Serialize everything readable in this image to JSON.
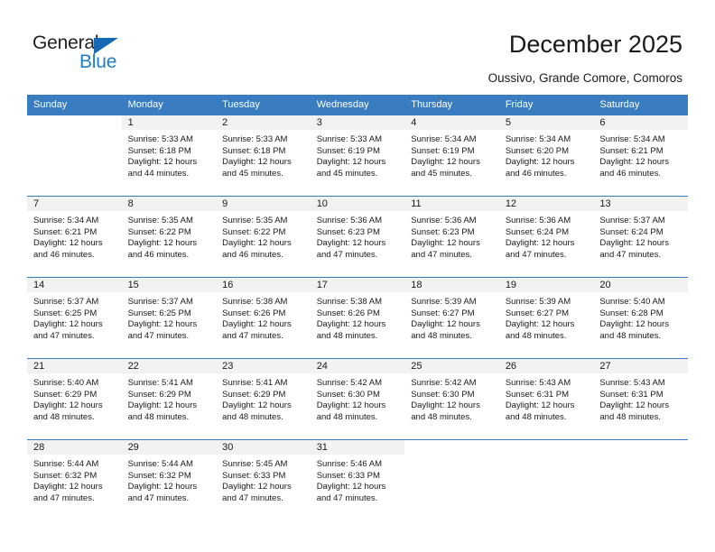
{
  "brand": {
    "name_part1": "General",
    "name_part2": "Blue",
    "accent_color": "#1f7fc4",
    "triangle_color": "#1769b5"
  },
  "header": {
    "title": "December 2025",
    "subtitle": "Oussivo, Grande Comore, Comoros"
  },
  "calendar": {
    "header_bg": "#3a7cc0",
    "weekdays": [
      "Sunday",
      "Monday",
      "Tuesday",
      "Wednesday",
      "Thursday",
      "Friday",
      "Saturday"
    ],
    "weeks": [
      [
        {
          "day": "",
          "sunrise": "",
          "sunset": "",
          "daylight1": "",
          "daylight2": ""
        },
        {
          "day": "1",
          "sunrise": "Sunrise: 5:33 AM",
          "sunset": "Sunset: 6:18 PM",
          "daylight1": "Daylight: 12 hours",
          "daylight2": "and 44 minutes."
        },
        {
          "day": "2",
          "sunrise": "Sunrise: 5:33 AM",
          "sunset": "Sunset: 6:18 PM",
          "daylight1": "Daylight: 12 hours",
          "daylight2": "and 45 minutes."
        },
        {
          "day": "3",
          "sunrise": "Sunrise: 5:33 AM",
          "sunset": "Sunset: 6:19 PM",
          "daylight1": "Daylight: 12 hours",
          "daylight2": "and 45 minutes."
        },
        {
          "day": "4",
          "sunrise": "Sunrise: 5:34 AM",
          "sunset": "Sunset: 6:19 PM",
          "daylight1": "Daylight: 12 hours",
          "daylight2": "and 45 minutes."
        },
        {
          "day": "5",
          "sunrise": "Sunrise: 5:34 AM",
          "sunset": "Sunset: 6:20 PM",
          "daylight1": "Daylight: 12 hours",
          "daylight2": "and 46 minutes."
        },
        {
          "day": "6",
          "sunrise": "Sunrise: 5:34 AM",
          "sunset": "Sunset: 6:21 PM",
          "daylight1": "Daylight: 12 hours",
          "daylight2": "and 46 minutes."
        }
      ],
      [
        {
          "day": "7",
          "sunrise": "Sunrise: 5:34 AM",
          "sunset": "Sunset: 6:21 PM",
          "daylight1": "Daylight: 12 hours",
          "daylight2": "and 46 minutes."
        },
        {
          "day": "8",
          "sunrise": "Sunrise: 5:35 AM",
          "sunset": "Sunset: 6:22 PM",
          "daylight1": "Daylight: 12 hours",
          "daylight2": "and 46 minutes."
        },
        {
          "day": "9",
          "sunrise": "Sunrise: 5:35 AM",
          "sunset": "Sunset: 6:22 PM",
          "daylight1": "Daylight: 12 hours",
          "daylight2": "and 46 minutes."
        },
        {
          "day": "10",
          "sunrise": "Sunrise: 5:36 AM",
          "sunset": "Sunset: 6:23 PM",
          "daylight1": "Daylight: 12 hours",
          "daylight2": "and 47 minutes."
        },
        {
          "day": "11",
          "sunrise": "Sunrise: 5:36 AM",
          "sunset": "Sunset: 6:23 PM",
          "daylight1": "Daylight: 12 hours",
          "daylight2": "and 47 minutes."
        },
        {
          "day": "12",
          "sunrise": "Sunrise: 5:36 AM",
          "sunset": "Sunset: 6:24 PM",
          "daylight1": "Daylight: 12 hours",
          "daylight2": "and 47 minutes."
        },
        {
          "day": "13",
          "sunrise": "Sunrise: 5:37 AM",
          "sunset": "Sunset: 6:24 PM",
          "daylight1": "Daylight: 12 hours",
          "daylight2": "and 47 minutes."
        }
      ],
      [
        {
          "day": "14",
          "sunrise": "Sunrise: 5:37 AM",
          "sunset": "Sunset: 6:25 PM",
          "daylight1": "Daylight: 12 hours",
          "daylight2": "and 47 minutes."
        },
        {
          "day": "15",
          "sunrise": "Sunrise: 5:37 AM",
          "sunset": "Sunset: 6:25 PM",
          "daylight1": "Daylight: 12 hours",
          "daylight2": "and 47 minutes."
        },
        {
          "day": "16",
          "sunrise": "Sunrise: 5:38 AM",
          "sunset": "Sunset: 6:26 PM",
          "daylight1": "Daylight: 12 hours",
          "daylight2": "and 47 minutes."
        },
        {
          "day": "17",
          "sunrise": "Sunrise: 5:38 AM",
          "sunset": "Sunset: 6:26 PM",
          "daylight1": "Daylight: 12 hours",
          "daylight2": "and 48 minutes."
        },
        {
          "day": "18",
          "sunrise": "Sunrise: 5:39 AM",
          "sunset": "Sunset: 6:27 PM",
          "daylight1": "Daylight: 12 hours",
          "daylight2": "and 48 minutes."
        },
        {
          "day": "19",
          "sunrise": "Sunrise: 5:39 AM",
          "sunset": "Sunset: 6:27 PM",
          "daylight1": "Daylight: 12 hours",
          "daylight2": "and 48 minutes."
        },
        {
          "day": "20",
          "sunrise": "Sunrise: 5:40 AM",
          "sunset": "Sunset: 6:28 PM",
          "daylight1": "Daylight: 12 hours",
          "daylight2": "and 48 minutes."
        }
      ],
      [
        {
          "day": "21",
          "sunrise": "Sunrise: 5:40 AM",
          "sunset": "Sunset: 6:29 PM",
          "daylight1": "Daylight: 12 hours",
          "daylight2": "and 48 minutes."
        },
        {
          "day": "22",
          "sunrise": "Sunrise: 5:41 AM",
          "sunset": "Sunset: 6:29 PM",
          "daylight1": "Daylight: 12 hours",
          "daylight2": "and 48 minutes."
        },
        {
          "day": "23",
          "sunrise": "Sunrise: 5:41 AM",
          "sunset": "Sunset: 6:29 PM",
          "daylight1": "Daylight: 12 hours",
          "daylight2": "and 48 minutes."
        },
        {
          "day": "24",
          "sunrise": "Sunrise: 5:42 AM",
          "sunset": "Sunset: 6:30 PM",
          "daylight1": "Daylight: 12 hours",
          "daylight2": "and 48 minutes."
        },
        {
          "day": "25",
          "sunrise": "Sunrise: 5:42 AM",
          "sunset": "Sunset: 6:30 PM",
          "daylight1": "Daylight: 12 hours",
          "daylight2": "and 48 minutes."
        },
        {
          "day": "26",
          "sunrise": "Sunrise: 5:43 AM",
          "sunset": "Sunset: 6:31 PM",
          "daylight1": "Daylight: 12 hours",
          "daylight2": "and 48 minutes."
        },
        {
          "day": "27",
          "sunrise": "Sunrise: 5:43 AM",
          "sunset": "Sunset: 6:31 PM",
          "daylight1": "Daylight: 12 hours",
          "daylight2": "and 48 minutes."
        }
      ],
      [
        {
          "day": "28",
          "sunrise": "Sunrise: 5:44 AM",
          "sunset": "Sunset: 6:32 PM",
          "daylight1": "Daylight: 12 hours",
          "daylight2": "and 47 minutes."
        },
        {
          "day": "29",
          "sunrise": "Sunrise: 5:44 AM",
          "sunset": "Sunset: 6:32 PM",
          "daylight1": "Daylight: 12 hours",
          "daylight2": "and 47 minutes."
        },
        {
          "day": "30",
          "sunrise": "Sunrise: 5:45 AM",
          "sunset": "Sunset: 6:33 PM",
          "daylight1": "Daylight: 12 hours",
          "daylight2": "and 47 minutes."
        },
        {
          "day": "31",
          "sunrise": "Sunrise: 5:46 AM",
          "sunset": "Sunset: 6:33 PM",
          "daylight1": "Daylight: 12 hours",
          "daylight2": "and 47 minutes."
        },
        {
          "day": "",
          "sunrise": "",
          "sunset": "",
          "daylight1": "",
          "daylight2": ""
        },
        {
          "day": "",
          "sunrise": "",
          "sunset": "",
          "daylight1": "",
          "daylight2": ""
        },
        {
          "day": "",
          "sunrise": "",
          "sunset": "",
          "daylight1": "",
          "daylight2": ""
        }
      ]
    ]
  }
}
